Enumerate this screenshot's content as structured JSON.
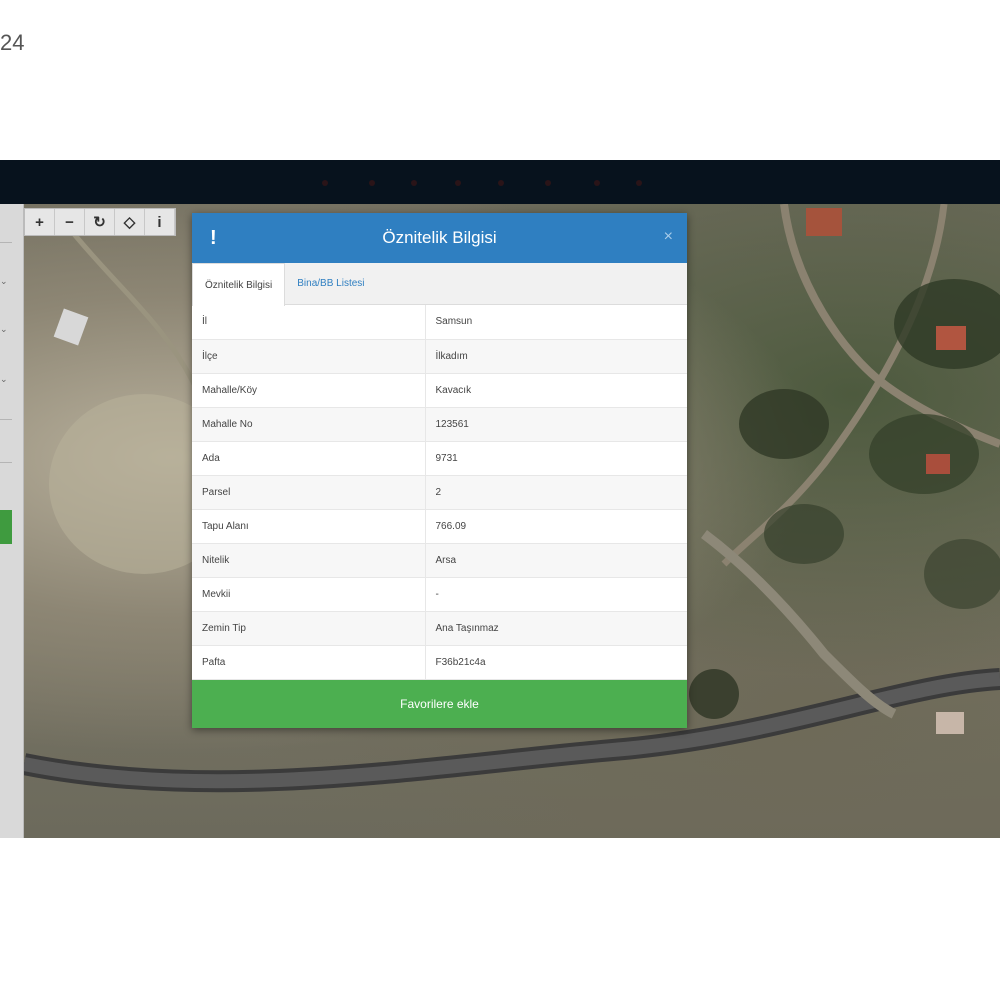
{
  "corner_text": "24",
  "colors": {
    "header": "#2f7fc1",
    "accent_green": "#4caf50",
    "topbar": "#07121d"
  },
  "map_toolbar": {
    "tools": [
      {
        "name": "zoom-in",
        "glyph": "+"
      },
      {
        "name": "zoom-out",
        "glyph": "−"
      },
      {
        "name": "refresh",
        "glyph": "↻"
      },
      {
        "name": "locate",
        "glyph": "◇"
      },
      {
        "name": "info",
        "glyph": "i"
      }
    ]
  },
  "modal": {
    "title": "Öznitelik Bilgisi",
    "warn_icon": "!",
    "close_icon": "×",
    "tabs": [
      {
        "label": "Öznitelik Bilgisi",
        "active": true
      },
      {
        "label": "Bina/BB Listesi",
        "active": false
      }
    ],
    "rows": [
      {
        "key": "İl",
        "value": "Samsun"
      },
      {
        "key": "İlçe",
        "value": "İlkadım"
      },
      {
        "key": "Mahalle/Köy",
        "value": "Kavacık"
      },
      {
        "key": "Mahalle No",
        "value": "123561"
      },
      {
        "key": "Ada",
        "value": "9731"
      },
      {
        "key": "Parsel",
        "value": "2"
      },
      {
        "key": "Tapu Alanı",
        "value": "766.09"
      },
      {
        "key": "Nitelik",
        "value": "Arsa"
      },
      {
        "key": "Mevkii",
        "value": "-"
      },
      {
        "key": "Zemin Tip",
        "value": "Ana Taşınmaz"
      },
      {
        "key": "Pafta",
        "value": "F36b21c4a"
      }
    ],
    "favorite_button": "Favorilere ekle"
  }
}
